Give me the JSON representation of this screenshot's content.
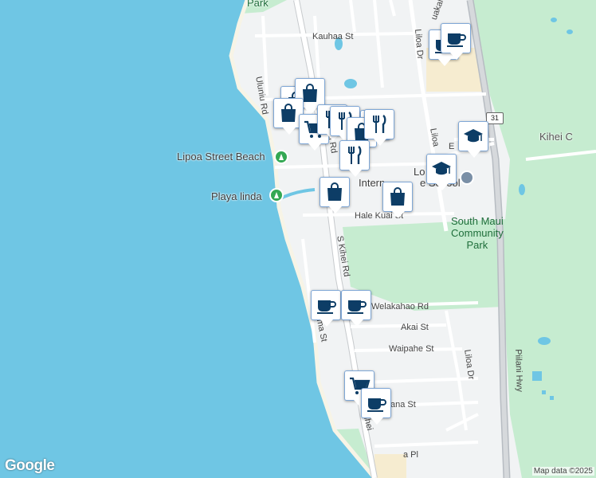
{
  "map": {
    "streets": {
      "kauhaa": "Kauhaa St",
      "uluniu": "Uluniu Rd",
      "s_kihei_top": "S Kihei Rd",
      "s_kihei_mid": "S Kihei Rd",
      "s_kihei_bottom": "Kihei",
      "liloa_top": "Liloa Dr",
      "liloa_mid": "Liloa",
      "liloa_bottom": "Liloa Dr",
      "hale_kuai": "Hale Kuai St",
      "welakahao": "Welakahao Rd",
      "akai": "Akai St",
      "waipahe": "Waipahe St",
      "kalama": "Kalama St",
      "piilani": "Piilani Hwy",
      "mana": "ana St",
      "pl": "a Pl",
      "uakahi": "uakahi",
      "e_street": "E"
    },
    "places": {
      "lipoa_beach": "Lipoa Street Beach",
      "playa_linda": "Playa linda",
      "south_maui_park": "South Maui\nCommunity\nPark",
      "kihei_c": "Kihei C",
      "school_partial_1": "Lo",
      "school_partial_2": "Intern",
      "school_partial_3": "e School",
      "park_top": "Park"
    },
    "highway_shield": "31",
    "attribution": "Map data ©2025",
    "google_logo": "Google",
    "markers": [
      {
        "icon": "coffee-icon"
      },
      {
        "icon": "coffee-icon"
      },
      {
        "icon": "shopping-bag-icon"
      },
      {
        "icon": "shopping-bag-icon"
      },
      {
        "icon": "shopping-bag-icon"
      },
      {
        "icon": "shopping-cart-icon"
      },
      {
        "icon": "restaurant-icon"
      },
      {
        "icon": "restaurant-icon"
      },
      {
        "icon": "shopping-bag-icon"
      },
      {
        "icon": "shopping-bag-icon"
      },
      {
        "icon": "restaurant-icon"
      },
      {
        "icon": "restaurant-icon"
      },
      {
        "icon": "school-icon"
      },
      {
        "icon": "school-icon"
      },
      {
        "icon": "shopping-bag-icon"
      },
      {
        "icon": "shopping-bag-icon"
      },
      {
        "icon": "coffee-icon"
      },
      {
        "icon": "coffee-icon"
      },
      {
        "icon": "shopping-cart-icon"
      },
      {
        "icon": "coffee-icon"
      }
    ],
    "colors": {
      "ocean": "#6fc6e4",
      "land": "#f1f3f4",
      "park": "#c6ecd0",
      "marker_icon": "#0d3d66",
      "highway": "#c9cdd1"
    }
  }
}
